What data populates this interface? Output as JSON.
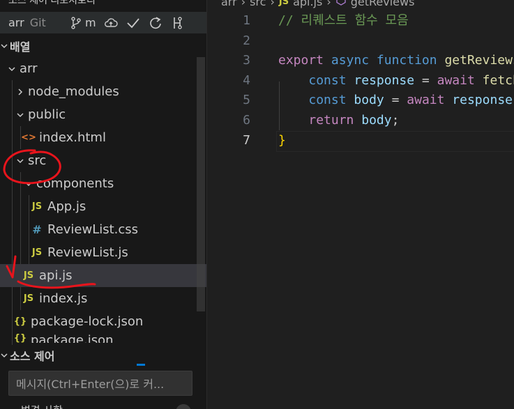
{
  "sidebar": {
    "top_cut_title": "소스 제어 리포지토리",
    "repo": {
      "name": "arr",
      "kind": "Git",
      "branch": "m"
    },
    "explorer_section": "배열",
    "tree": [
      {
        "label": "arr",
        "type": "folder-open",
        "depth": 0
      },
      {
        "label": "node_modules",
        "type": "folder-closed",
        "depth": 1
      },
      {
        "label": "public",
        "type": "folder-open",
        "depth": 1
      },
      {
        "label": "index.html",
        "type": "html",
        "depth": 2,
        "icon": "<>"
      },
      {
        "label": "src",
        "type": "folder-open",
        "depth": 1
      },
      {
        "label": "components",
        "type": "folder-open",
        "depth": 2
      },
      {
        "label": "App.js",
        "type": "js",
        "depth": 3,
        "icon": "JS"
      },
      {
        "label": "ReviewList.css",
        "type": "css",
        "depth": 3,
        "icon": "#"
      },
      {
        "label": "ReviewList.js",
        "type": "js",
        "depth": 3,
        "icon": "JS"
      },
      {
        "label": "api.js",
        "type": "js",
        "depth": 2,
        "icon": "JS",
        "selected": true
      },
      {
        "label": "index.js",
        "type": "js",
        "depth": 2,
        "icon": "JS"
      },
      {
        "label": "package-lock.json",
        "type": "json",
        "depth": 1,
        "icon": "{}"
      },
      {
        "label": "package.json",
        "type": "json",
        "depth": 1,
        "icon": "{}"
      }
    ],
    "source_control_header": "소스 제어",
    "commit_placeholder": "메시지(Ctrl+Enter(으)로 커...",
    "bottom_cut_text": "변경 사항"
  },
  "editor": {
    "breadcrumb": [
      "arr",
      "src",
      "api.js",
      "getReviews"
    ],
    "breadcrumb_js_icon": "JS",
    "line_numbers": [
      "1",
      "2",
      "3",
      "4",
      "5",
      "6",
      "7"
    ],
    "active_line": "7",
    "code": {
      "l1": "// 리퀘스트 함수 모음",
      "l3_export": "export",
      "l3_async": "async",
      "l3_function": "function",
      "l3_name": "getReviews",
      "l4_const": "const",
      "l4_var": "response",
      "l4_eq": " = ",
      "l4_await": "await",
      "l4_rest": "fetch",
      "l5_const": "const",
      "l5_var": "body",
      "l5_eq": " = ",
      "l5_await": "await",
      "l5_rest": "response",
      "l6_return": "return",
      "l6_var": "body",
      "l6_semi": ";",
      "l7": "}"
    }
  },
  "colors": {
    "annotation_red": "#e8141c",
    "accent_blue": "#0078d4"
  }
}
